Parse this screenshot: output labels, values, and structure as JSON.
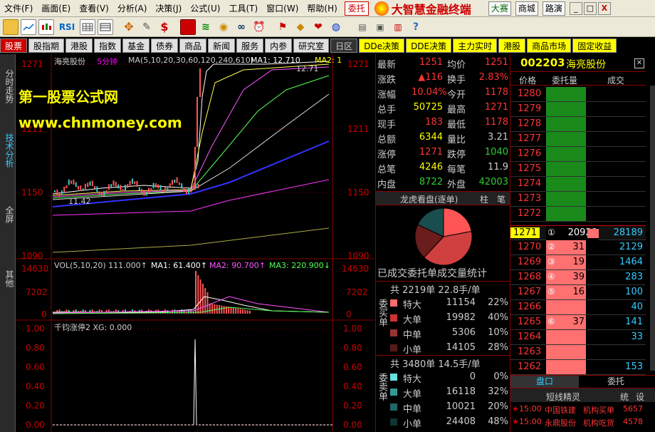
{
  "menu": [
    "文件(F)",
    "画面(E)",
    "查看(V)",
    "分析(A)",
    "决策(J)",
    "公式(U)",
    "工具(T)",
    "窗口(W)",
    "帮助(H)"
  ],
  "window_tab": "委托",
  "brand": "大智慧金融终端",
  "top_links": [
    "大赛",
    "商城",
    "路演"
  ],
  "win_controls": [
    "_",
    "□",
    "X"
  ],
  "toolbar": {
    "rsi_label": "RSI",
    "dollar_label": "$"
  },
  "tabs": [
    "股票",
    "股指期",
    "港股",
    "指数",
    "基金",
    "债券",
    "商品",
    "新闻",
    "服务",
    "内参",
    "研究室",
    "日区",
    "DDe决策",
    "DDE决策",
    "主力实时",
    "港股",
    "商品市场",
    "固定收益"
  ],
  "rail": [
    "分时走势",
    "技术分析",
    "全屏",
    "其他"
  ],
  "watermark": {
    "line1": "第一股票公式网",
    "line2": "www.chnmoney.com"
  },
  "main_chart": {
    "stock": "海亮股份",
    "period": "5分钟",
    "ma_legend": "MA(5,10,20,30,60,120,240,610)",
    "ma1_label": "MA1: 12.710",
    "ma2_label": "MA2: 1",
    "ma_value_right": "12.71",
    "low_marker": "11.42",
    "y_ticks": [
      "1271",
      "1211",
      "1150",
      "1090"
    ],
    "y_ticks_right": [
      "1271",
      "1211",
      "1150",
      "1090"
    ]
  },
  "vol_chart": {
    "legend": "VOL(5,10,20) 111.000↑",
    "ma1": "MA1: 61.400↑",
    "ma2": "MA2: 90.700↑",
    "ma3": "MA3: 220.900↓",
    "y_ticks": [
      "14630",
      "7202",
      "0"
    ]
  },
  "xg_chart": {
    "legend": "千钧涨停2 XG: 0.000",
    "y_ticks": [
      "1.00",
      "0.80",
      "0.60",
      "0.40",
      "0.20",
      "0.00"
    ]
  },
  "quote": {
    "rows": [
      {
        "l1": "最新",
        "v1": "1251",
        "l2": "均价",
        "v2": "1251"
      },
      {
        "l1": "涨跌",
        "v1": "▲116",
        "l2": "换手",
        "v2": "2.83%"
      },
      {
        "l1": "涨幅",
        "v1": "10.04%",
        "l2": "今开",
        "v2": "1178"
      },
      {
        "l1": "总手",
        "v1": "50725",
        "l2": "最高",
        "v2": "1271"
      },
      {
        "l1": "现手",
        "v1": "183",
        "l2": "最低",
        "v2": "1178"
      },
      {
        "l1": "总额",
        "v1": "6344",
        "l2": "量比",
        "v2": "3.21"
      },
      {
        "l1": "涨停",
        "v1": "1271",
        "l2": "跌停",
        "v2": "1040"
      },
      {
        "l1": "总笔",
        "v1": "4246",
        "l2": "每笔",
        "v2": "11.9"
      },
      {
        "l1": "内盘",
        "v1": "8722",
        "l2": "外盘",
        "v2": "42003"
      }
    ],
    "lhb_title": "龙虎看盘(逐单)",
    "lhb_btn1": "柱",
    "lhb_btn2": "笔",
    "pie": [
      {
        "value": 22,
        "color": "#ff5555"
      },
      {
        "value": 40,
        "color": "#d04040"
      },
      {
        "value": 20,
        "color": "#6b1c1c"
      },
      {
        "value": 18,
        "color": "#1a4d4d"
      }
    ],
    "stats_title": "已成交委托单成交量统计",
    "buy": {
      "header": "共 2219单 22.8手/单",
      "side": "委买单",
      "rows": [
        {
          "label": "特大",
          "v": "11154",
          "p": "22%",
          "c": "#ff6a6a"
        },
        {
          "label": "大单",
          "v": "19982",
          "p": "40%",
          "c": "#cc3333"
        },
        {
          "label": "中单",
          "v": "5306",
          "p": "10%",
          "c": "#993333"
        },
        {
          "label": "小单",
          "v": "14105",
          "p": "28%",
          "c": "#551a1a"
        }
      ]
    },
    "sell": {
      "header": "共 3480单 14.5手/单",
      "side": "委卖单",
      "rows": [
        {
          "label": "特大",
          "v": "0",
          "p": "0%",
          "c": "#66e0e0"
        },
        {
          "label": "大单",
          "v": "16118",
          "p": "32%",
          "c": "#339999"
        },
        {
          "label": "中单",
          "v": "10021",
          "p": "20%",
          "c": "#226666"
        },
        {
          "label": "小单",
          "v": "24408",
          "p": "48%",
          "c": "#113333"
        }
      ]
    }
  },
  "book": {
    "code": "002203",
    "name": "海亮股份",
    "col_price": "价格",
    "col_qty": "委托量",
    "col_deal": "成交",
    "asks": [
      "1280",
      "1279",
      "1278",
      "1277",
      "1276",
      "1275",
      "1274",
      "1273",
      "1272"
    ],
    "bids": [
      {
        "price": "1271",
        "idx": "①",
        "qty": "20920",
        "deal": "28189"
      },
      {
        "price": "1270",
        "idx": "②",
        "qty": "31",
        "deal": "2129"
      },
      {
        "price": "1269",
        "idx": "③",
        "qty": "19",
        "deal": "1464"
      },
      {
        "price": "1268",
        "idx": "④",
        "qty": "39",
        "deal": "283"
      },
      {
        "price": "1267",
        "idx": "⑤",
        "qty": "16",
        "deal": "100"
      },
      {
        "price": "1266",
        "idx": "",
        "qty": "",
        "deal": "40"
      },
      {
        "price": "1265",
        "idx": "⑥",
        "qty": "37",
        "deal": "141"
      },
      {
        "price": "1264",
        "idx": "",
        "qty": "",
        "deal": "33"
      },
      {
        "price": "1263",
        "idx": "",
        "qty": "",
        "deal": ""
      },
      {
        "price": "1262",
        "idx": "",
        "qty": "",
        "deal": "153"
      }
    ],
    "tab_left": "盘口",
    "tab_right": "委托",
    "news_title": "短线精灵",
    "news_btns": [
      "统",
      "设"
    ],
    "news": [
      {
        "t": "15:00",
        "stock": "中国铁建",
        "desc": "机构买单",
        "num": "5657"
      },
      {
        "t": "15:00",
        "stock": "永鼎股份",
        "desc": "机构吃货",
        "num": "4578"
      }
    ]
  },
  "colors": {
    "up": "#ff3333",
    "down": "#33cc33",
    "yellow": "#ffff00",
    "cyan": "#33ffff",
    "frame": "#800000"
  }
}
